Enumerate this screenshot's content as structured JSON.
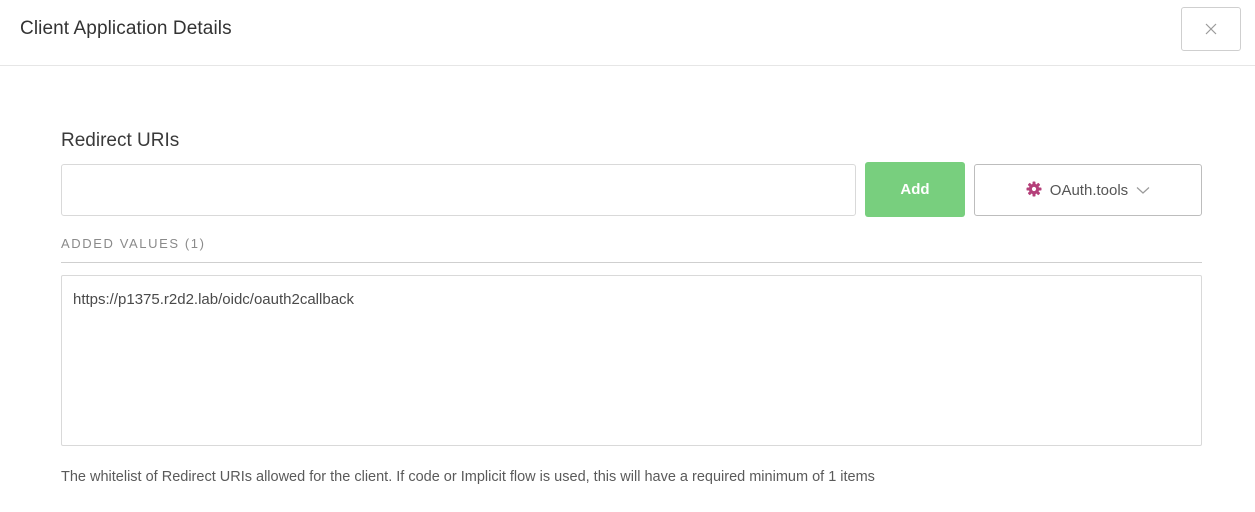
{
  "dialog": {
    "title": "Client Application Details",
    "close_icon": "close-icon"
  },
  "redirect_uris": {
    "label": "Redirect URIs",
    "input_value": "",
    "input_placeholder": "",
    "add_label": "Add",
    "add_color": "#78cf7e",
    "tools_label": "OAuth.tools",
    "tools_icon": "gear-icon",
    "tools_icon_color": "#b5407a",
    "added_values_label": "ADDED VALUES (1)",
    "values": [
      "https://p1375.r2d2.lab/oidc/oauth2callback"
    ],
    "help_text": "The whitelist of Redirect URIs allowed for the client. If code or Implicit flow is used, this will have a required minimum of 1 items"
  }
}
